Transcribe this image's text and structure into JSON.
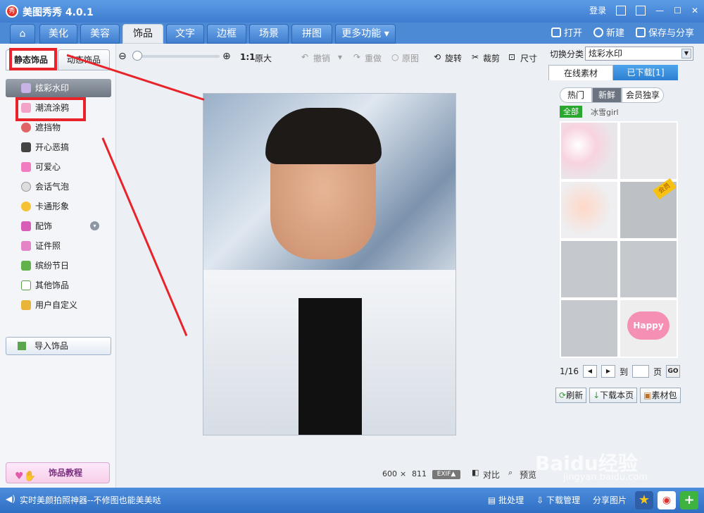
{
  "app": {
    "title": "美图秀秀 4.0.1",
    "logo_text": "秀"
  },
  "titlebar": {
    "login": "登录"
  },
  "nav": {
    "tabs": [
      "美化",
      "美容",
      "饰品",
      "文字",
      "边框",
      "场景",
      "拼图",
      "更多功能"
    ],
    "active": "饰品",
    "actions": {
      "open": "打开",
      "new": "新建",
      "save": "保存与分享"
    }
  },
  "left": {
    "subtabs": {
      "static": "静态饰品",
      "dynamic": "动态饰品"
    },
    "categories": [
      "炫彩水印",
      "潮流涂鸦",
      "遮挡物",
      "开心恶搞",
      "可爱心",
      "会话气泡",
      "卡通形象",
      "配饰",
      "证件照",
      "缤纷节日",
      "其他饰品",
      "用户自定义"
    ],
    "import_label": "导入饰品",
    "tutorial_label": "饰品教程"
  },
  "toolbar": {
    "zoom_ratio": "1:1",
    "original_size": "原大",
    "undo": "撤销",
    "redo": "重做",
    "original": "原图",
    "rotate": "旋转",
    "crop": "裁剪",
    "size": "尺寸"
  },
  "canvas": {
    "width": "600",
    "times": "×",
    "height": "811",
    "exif": "EXIF▲",
    "compare": "对比",
    "preview": "预览"
  },
  "right": {
    "category_label": "切换分类",
    "category_value": "炫彩水印",
    "tab_online": "在线素材",
    "tab_downloaded": "已下载[1]",
    "filters": [
      "热门",
      "新鲜",
      "会员独享"
    ],
    "filter_active": "新鲜",
    "all_badge": "全部",
    "subfilter": "冰雪girl",
    "vip_badge": "会员",
    "happy_text": "Happy",
    "pager": {
      "current": "1/16",
      "goto_label": "到",
      "page_label": "页",
      "go": "GO"
    },
    "buttons": {
      "refresh": "刷新",
      "download_page": "下载本页",
      "package": "素材包"
    }
  },
  "statusbar": {
    "tip": "实时美颜拍照神器--不修图也能美美哒",
    "batch": "批处理",
    "download_mgr": "下载管理",
    "share": "分享图片"
  },
  "watermark": {
    "brand": "Baidu经验",
    "url": "jingyan.baidu.com"
  }
}
